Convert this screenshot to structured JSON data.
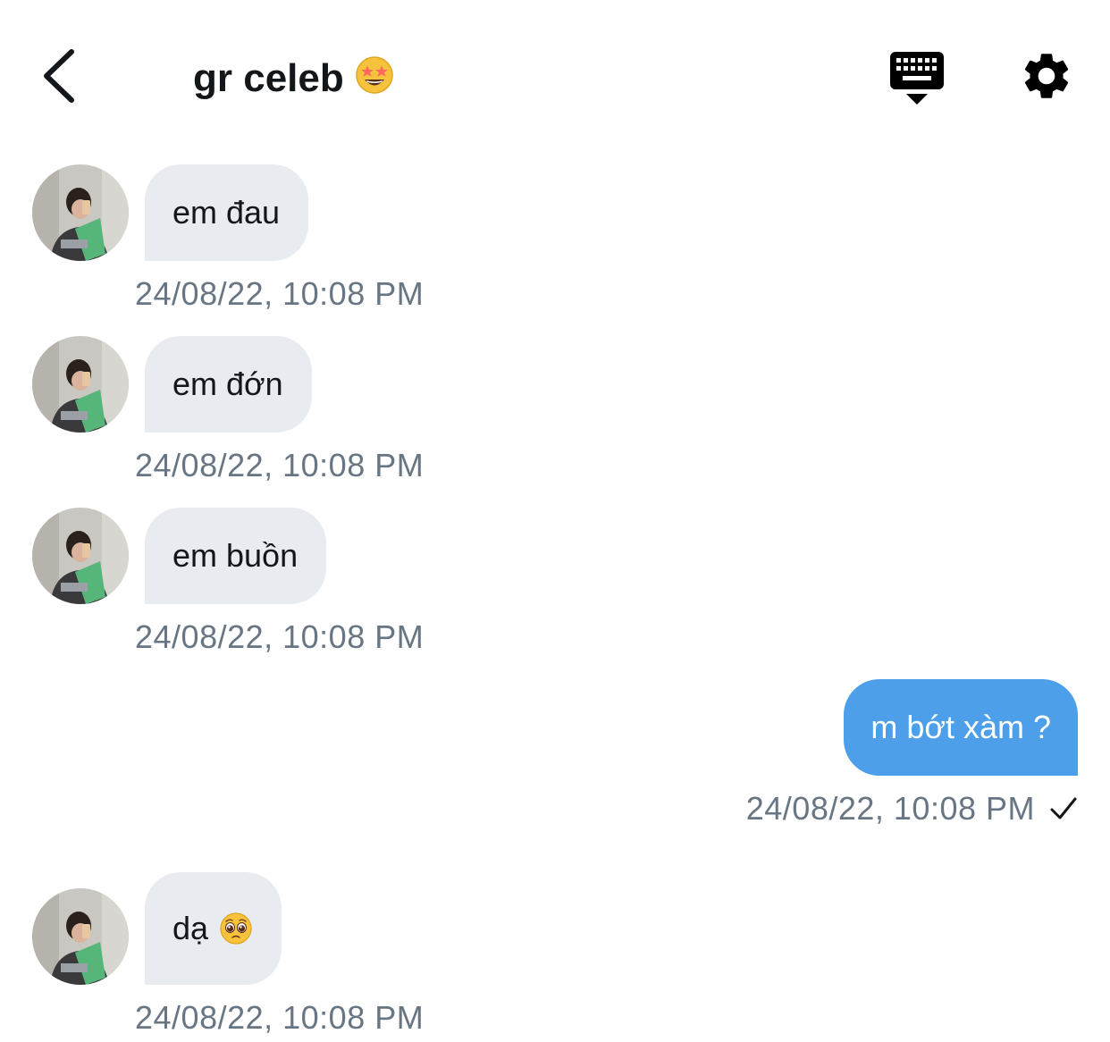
{
  "header": {
    "title": "gr celeb",
    "title_emoji": "🤩",
    "back_icon": "chevron-left-icon",
    "keyboard_icon": "keyboard-hide-icon",
    "settings_icon": "gear-icon"
  },
  "messages": [
    {
      "direction": "incoming",
      "text": "em đau",
      "timestamp": "24/08/22, 10:08 PM"
    },
    {
      "direction": "incoming",
      "text": "em đớn",
      "timestamp": "24/08/22, 10:08 PM"
    },
    {
      "direction": "incoming",
      "text": "em buồn",
      "timestamp": "24/08/22, 10:08 PM"
    },
    {
      "direction": "outgoing",
      "text": "m bớt xàm ?",
      "timestamp": "24/08/22, 10:08 PM",
      "status_icon": "check-icon"
    },
    {
      "direction": "incoming",
      "text": "dạ",
      "emoji": "🥺",
      "timestamp": "24/08/22, 10:08 PM"
    }
  ],
  "colors": {
    "incoming_bubble": "#e8ebef",
    "outgoing_bubble": "#4c9fe8",
    "timestamp": "#687684",
    "text": "#14171a"
  }
}
